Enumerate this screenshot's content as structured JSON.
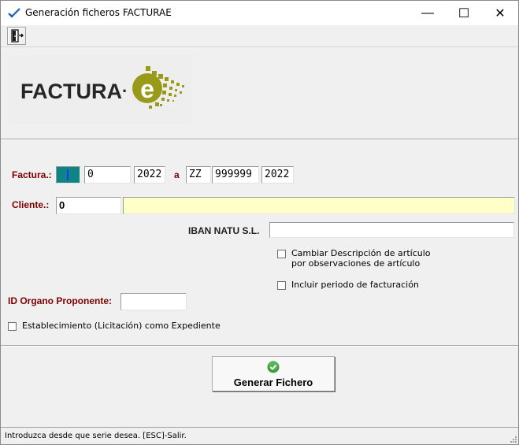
{
  "window": {
    "title": "Generación ficheros FACTURAE",
    "minimize_glyph": "—",
    "maximize_glyph": "☐",
    "close_glyph": "✕"
  },
  "toolbar": {
    "exit_icon": "exit-door-icon"
  },
  "logo": {
    "text": "FACTURA",
    "dot": "·",
    "letter": "e",
    "text_color": "#262626",
    "accent_color": "#9a9a1a"
  },
  "invoice": {
    "label": "Factura.:",
    "from_serie": "",
    "from_number": "0",
    "from_year": "2022",
    "to_label": "a",
    "to_serie": "ZZ",
    "to_number": "999999",
    "to_year": "2022"
  },
  "client": {
    "label": "Cliente.:",
    "code": "0",
    "name": ""
  },
  "iban": {
    "label": "IBAN NATU S.L.",
    "value": ""
  },
  "options": {
    "change_description_line1": "Cambiar Descripción de artículo",
    "change_description_line2": "por  observaciones de artículo",
    "include_period": "Incluir periodo de facturación",
    "establishment_expedient": "Establecimiento (Licitación) como Expediente"
  },
  "organ": {
    "label": "ID Organo Proponente:",
    "value": ""
  },
  "actions": {
    "generate_label": "Generar Fichero"
  },
  "status": {
    "message": "Introduzca desde que serie desea.   [ESC]-Salir."
  },
  "colors": {
    "label_red": "#7f0000",
    "serie_teal": "#0f8484",
    "client_yellow": "#ffffc8",
    "accent_green": "#3c9c3c"
  }
}
